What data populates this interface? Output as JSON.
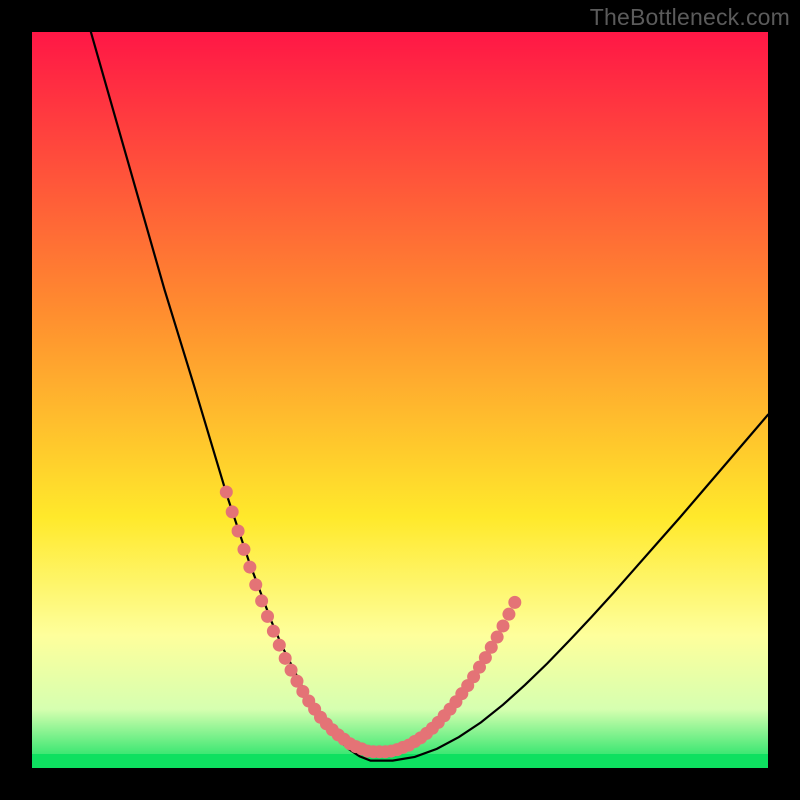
{
  "watermark": "TheBottleneck.com",
  "colors": {
    "frame": "#000000",
    "curve": "#000000",
    "dots": "#e47376",
    "green": "#0ee060",
    "gradient_top": "#ff1746",
    "gradient_mid1": "#ff8d2f",
    "gradient_mid2": "#ffe92b",
    "gradient_low1": "#feff9c",
    "gradient_low2": "#d6ffb0",
    "gradient_bottom": "#0ee060"
  },
  "chart_data": {
    "type": "line",
    "title": "",
    "xlabel": "",
    "ylabel": "",
    "xlim": [
      0,
      100
    ],
    "ylim": [
      0,
      100
    ],
    "series": [
      {
        "name": "bottleneck-curve",
        "x": [
          8,
          10,
          12,
          14,
          16,
          18,
          20,
          22,
          23.5,
          25,
          26.5,
          28,
          29.5,
          31,
          32.5,
          34,
          35.5,
          37,
          38.5,
          40,
          41.5,
          43,
          44.5,
          46,
          49,
          52,
          55,
          58,
          61,
          64,
          67,
          70,
          73,
          76,
          79,
          82,
          85,
          88,
          91,
          94,
          97,
          100
        ],
        "y": [
          100,
          93,
          86,
          79,
          72,
          65,
          58.5,
          52,
          47,
          42,
          37,
          32.5,
          28,
          24,
          20,
          16.5,
          13.5,
          10.5,
          8,
          5.8,
          4,
          2.6,
          1.6,
          1,
          1,
          1.5,
          2.6,
          4.2,
          6.2,
          8.6,
          11.3,
          14.2,
          17.3,
          20.5,
          23.8,
          27.2,
          30.6,
          34,
          37.5,
          41,
          44.5,
          48
        ]
      }
    ],
    "scatter": {
      "name": "highlight-dots",
      "points": [
        [
          26.4,
          37.5
        ],
        [
          27.2,
          34.8
        ],
        [
          28.0,
          32.2
        ],
        [
          28.8,
          29.7
        ],
        [
          29.6,
          27.3
        ],
        [
          30.4,
          24.9
        ],
        [
          31.2,
          22.7
        ],
        [
          32.0,
          20.6
        ],
        [
          32.8,
          18.6
        ],
        [
          33.6,
          16.7
        ],
        [
          34.4,
          14.9
        ],
        [
          35.2,
          13.3
        ],
        [
          36.0,
          11.8
        ],
        [
          36.8,
          10.4
        ],
        [
          37.6,
          9.1
        ],
        [
          38.4,
          8.0
        ],
        [
          39.2,
          6.9
        ],
        [
          40.0,
          6.0
        ],
        [
          40.8,
          5.2
        ],
        [
          41.6,
          4.5
        ],
        [
          42.4,
          3.9
        ],
        [
          43.2,
          3.3
        ],
        [
          44.0,
          2.9
        ],
        [
          44.8,
          2.6
        ],
        [
          45.6,
          2.3
        ],
        [
          46.4,
          2.2
        ],
        [
          47.2,
          2.2
        ],
        [
          48.0,
          2.2
        ],
        [
          48.8,
          2.3
        ],
        [
          49.6,
          2.5
        ],
        [
          50.4,
          2.8
        ],
        [
          51.2,
          3.1
        ],
        [
          52.0,
          3.6
        ],
        [
          52.8,
          4.1
        ],
        [
          53.6,
          4.7
        ],
        [
          54.4,
          5.4
        ],
        [
          55.2,
          6.2
        ],
        [
          56.0,
          7.1
        ],
        [
          56.8,
          8.0
        ],
        [
          57.6,
          9.0
        ],
        [
          58.4,
          10.1
        ],
        [
          59.2,
          11.2
        ],
        [
          60.0,
          12.4
        ],
        [
          60.8,
          13.7
        ],
        [
          61.6,
          15.0
        ],
        [
          62.4,
          16.4
        ],
        [
          63.2,
          17.8
        ],
        [
          64.0,
          19.3
        ],
        [
          64.8,
          20.9
        ],
        [
          65.6,
          22.5
        ]
      ]
    },
    "legend": []
  }
}
